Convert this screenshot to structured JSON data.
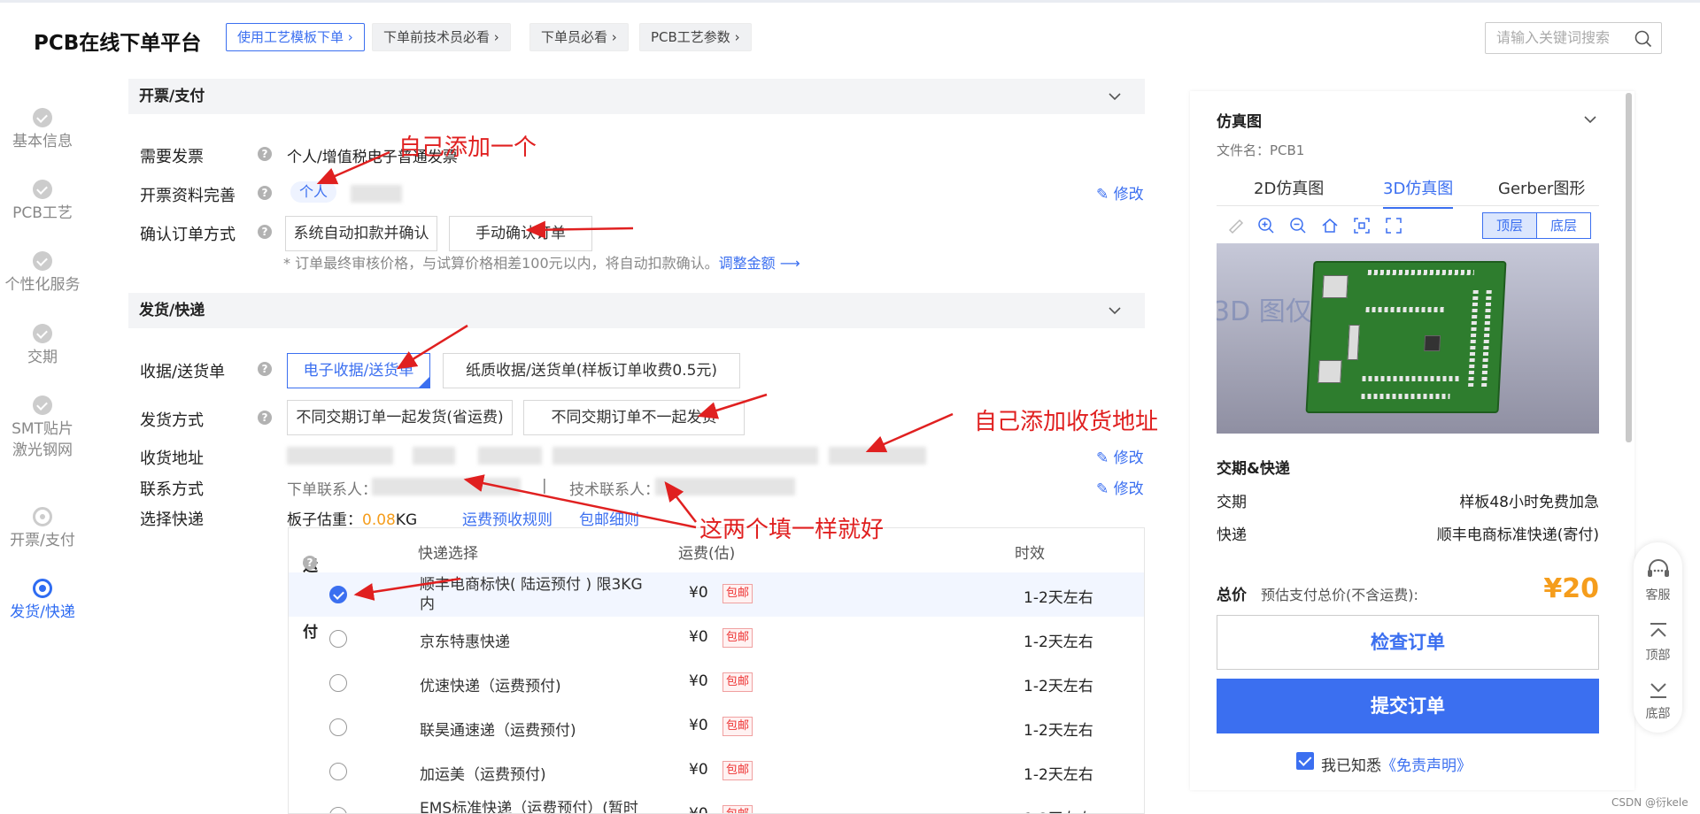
{
  "header": {
    "logo": "PCB在线下单平台",
    "links": [
      "使用工艺模板下单",
      "下单前技术员必看",
      "下单员必看",
      "PCB工艺参数"
    ],
    "search_placeholder": "请输入关键词搜索"
  },
  "steps": [
    {
      "label": "基本信息",
      "state": "done"
    },
    {
      "label": "PCB工艺",
      "state": "done"
    },
    {
      "label": "个性化服务",
      "state": "done"
    },
    {
      "label": "交期",
      "state": "done"
    },
    {
      "label": "SMT贴片\n激光钢网",
      "state": "done"
    },
    {
      "label": "开票/支付",
      "state": "pending"
    },
    {
      "label": "发货/快递",
      "state": "active"
    }
  ],
  "invoice": {
    "title": "开票/支付",
    "need_label": "需要发票",
    "need_value": "个人/增值税电子普通发票",
    "info_label": "开票资料完善",
    "info_value": "个人",
    "edit_label": "修改",
    "confirm_label": "确认订单方式",
    "options": [
      "系统自动扣款并确认",
      "手动确认订单"
    ],
    "note": "* 订单最终审核价格，与试算价格相差100元以内，将自动扣款确认。",
    "note_link": "调整金额 ⟶"
  },
  "shipping": {
    "title": "发货/快递",
    "receipt_label": "收据/送货单",
    "receipt_options": [
      "电子收据/送货单",
      "纸质收据/送货单(样板订单收费0.5元)"
    ],
    "ship_label": "发货方式",
    "ship_options": [
      "不同交期订单一起发货(省运费)",
      "不同交期订单不一起发货"
    ],
    "address_label": "收货地址",
    "contact_label": "联系方式",
    "order_contact": "下单联系人：",
    "tech_contact": "技术联系人：",
    "divider": "|",
    "courier_label": "选择快递",
    "weight_label": "板子估重：",
    "weight_value": "0.08",
    "weight_unit": "KG",
    "rules_link": "运费预收规则",
    "free_link": "包邮细则",
    "edit_label": "修改"
  },
  "table": {
    "headers": [
      "运费预付",
      "快递选择",
      "运费(估)",
      "时效"
    ],
    "rows": [
      {
        "name": "顺丰电商标快( 陆运预付 )    限3KG内",
        "fee": "¥0",
        "tag": "包邮",
        "eff": "1-2天左右",
        "selected": true
      },
      {
        "name": "京东特惠快递",
        "fee": "¥0",
        "tag": "包邮",
        "eff": "1-2天左右",
        "selected": false
      },
      {
        "name": "优速快递（运费预付)",
        "fee": "¥0",
        "tag": "包邮",
        "eff": "1-2天左右",
        "selected": false
      },
      {
        "name": "联昊通速递（运费预付)",
        "fee": "¥0",
        "tag": "包邮",
        "eff": "1-2天左右",
        "selected": false
      },
      {
        "name": "加运美（运费预付)",
        "fee": "¥0",
        "tag": "包邮",
        "eff": "1-2天左右",
        "selected": false
      },
      {
        "name": "EMS标准快递（运费预付）(暂时",
        "fee": "¥0",
        "tag": "包邮",
        "eff": "1-2天左右",
        "selected": false
      }
    ]
  },
  "right": {
    "title": "仿真图",
    "file": "文件名：PCB1",
    "tabs": [
      "2D仿真图",
      "3D仿真图",
      "Gerber图形"
    ],
    "active_tab": 1,
    "layers": [
      "顶层",
      "底层"
    ],
    "watermark": "3D 图仅                实物为准",
    "delivery_title": "交期&快递",
    "delivery_label": "交期",
    "delivery_value": "样板48小时免费加急",
    "express_label": "快递",
    "express_value": "顺丰电商标准快递(寄付)",
    "total_label": "总价",
    "total_sub": "预估支付总价(不含运费):",
    "total_price": "¥20",
    "check_btn": "检查订单",
    "submit_btn": "提交订单",
    "agree_text": "我已知悉",
    "agree_link": "《免责声明》"
  },
  "float": [
    "客服",
    "顶部",
    "底部"
  ],
  "credit": "CSDN @衍kele",
  "annotations": {
    "a1": "自己添加一个",
    "a2": "自己添加收货地址",
    "a3": "这两个填一样就好"
  },
  "colors": {
    "accent": "#3b6ff0",
    "price": "#f59d1c",
    "annotation": "#e02020"
  }
}
